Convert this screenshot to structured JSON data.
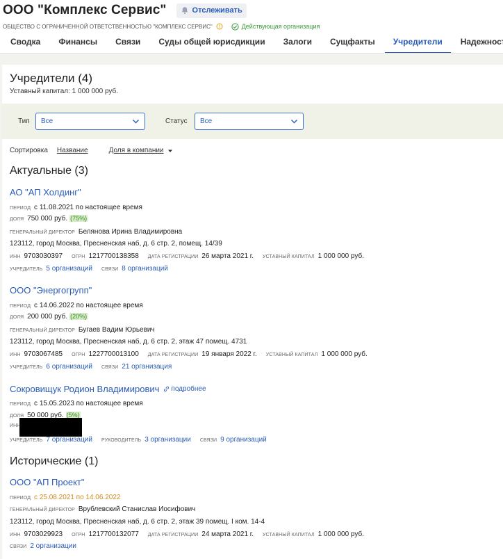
{
  "company": {
    "title": "ООО \"Комплекс Сервис\"",
    "follow_label": "Отслеживать",
    "full_name": "ОБЩЕСТВО С ОГРАНИЧЕННОЙ ОТВЕТСТВЕННОСТЬЮ \"КОМПЛЕКС СЕРВИС\"",
    "status": "Действующая организация"
  },
  "tabs": [
    {
      "label": "Сводка"
    },
    {
      "label": "Финансы"
    },
    {
      "label": "Связи"
    },
    {
      "label": "Суды общей юрисдикции"
    },
    {
      "label": "Залоги"
    },
    {
      "label": "Сущфакты"
    },
    {
      "label": "Учредители",
      "active": true
    },
    {
      "label": "Надежность"
    }
  ],
  "founders": {
    "title": "Учредители (4)",
    "capital": "Уставный капитал: 1 000 000 руб."
  },
  "filters": {
    "type_label": "Тип",
    "type_value": "Все",
    "status_label": "Статус",
    "status_value": "Все"
  },
  "sort": {
    "label": "Сортировка",
    "by_name": "Название",
    "by_share": "Доля в компании"
  },
  "labels": {
    "period": "период",
    "share": "доля",
    "director": "генеральный директор",
    "inn": "инн",
    "ogrn": "огрн",
    "reg_date": "дата регистрации",
    "capital": "уставный капитал",
    "founder": "учредитель",
    "links": "связи",
    "head": "руководитель"
  },
  "current": {
    "title": "Актуальные (3)",
    "entries": [
      {
        "name": "АО \"АП Холдинг\"",
        "period": "с 11.08.2021 по настоящее время",
        "share": "750 000 руб.",
        "share_pct": "(75%)",
        "director": "Белянова Ирина Владимировна",
        "address": "123112, город Москва, Пресненская наб, д. 6 стр. 2, помещ. 14/39",
        "inn": "9703030397",
        "ogrn": "1217700138358",
        "reg_date": "26 марта 2021 г.",
        "capital": "1 000 000 руб.",
        "founder_link": "5 организаций",
        "links_link": "8 организаций"
      },
      {
        "name": "ООО \"Энергогрупп\"",
        "period": "с 14.06.2022 по настоящее время",
        "share": "200 000 руб.",
        "share_pct": "(20%)",
        "director": "Бугаев Вадим Юрьевич",
        "address": "123112, город Москва, Пресненская наб, д. 6 стр. 2, этаж 47 помещ. 4731",
        "inn": "9703067485",
        "ogrn": "1227700013100",
        "reg_date": "19 января 2022 г.",
        "capital": "1 000 000 руб.",
        "founder_link": "6 организаций",
        "links_link": "21 организация"
      },
      {
        "name": "Сокровищук Родион Владимирович",
        "more": "подробнее",
        "period": "с 15.05.2023 по настоящее время",
        "share": "50 000 руб.",
        "share_pct": "(5%)",
        "founder_link": "7 организаций",
        "head_link": "3 организации",
        "links_link": "9 организаций"
      }
    ]
  },
  "historical": {
    "title": "Исторические (1)",
    "entries": [
      {
        "name": "ООО \"АП Проект\"",
        "period": "с 25.08.2021 по 14.06.2022",
        "director": "Врублевский Станислав Иосифович",
        "address": "123112, город Москва, Пресненская наб, д. 6 стр. 2, этаж 39 помещ. I ком. 14-4",
        "inn": "9703029923",
        "ogrn": "1217700132077",
        "reg_date": "24 марта 2021 г.",
        "capital": "1 000 000 руб.",
        "links_link": "2 организации"
      }
    ]
  },
  "colors": {
    "accent": "#2a5bb8",
    "active_status": "#3a9a3a",
    "historical_period": "#d08a1c",
    "share_badge_bg": "#d8ecc8"
  }
}
